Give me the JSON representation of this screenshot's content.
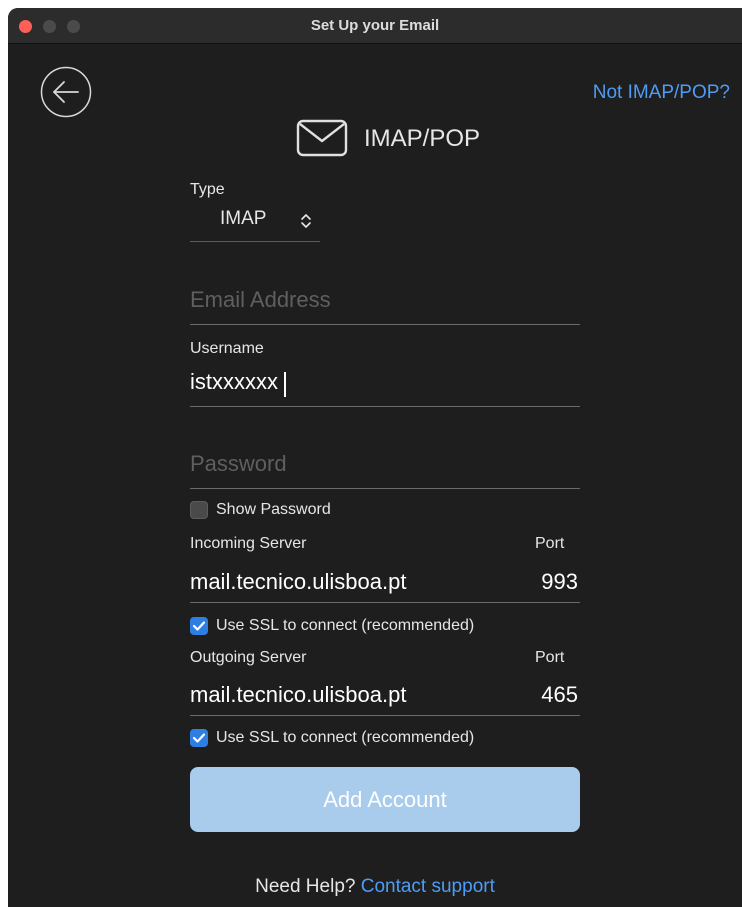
{
  "window": {
    "title": "Set Up your Email"
  },
  "header": {
    "not_imap_link": "Not IMAP/POP?",
    "title": "IMAP/POP"
  },
  "form": {
    "type_label": "Type",
    "type_value": "IMAP",
    "email_placeholder": "Email Address",
    "username_label": "Username",
    "username_value": "istxxxxxx",
    "password_placeholder": "Password",
    "show_password_label": "Show Password",
    "incoming_label": "Incoming Server",
    "incoming_port_label": "Port",
    "incoming_server": "mail.tecnico.ulisboa.pt",
    "incoming_port": "993",
    "incoming_ssl_label": "Use SSL to connect (recommended)",
    "outgoing_label": "Outgoing Server",
    "outgoing_port_label": "Port",
    "outgoing_server": "mail.tecnico.ulisboa.pt",
    "outgoing_port": "465",
    "outgoing_ssl_label": "Use SSL to connect (recommended)"
  },
  "actions": {
    "add_account": "Add Account"
  },
  "help": {
    "prefix": "Need Help?",
    "link": "Contact support"
  },
  "icons": {
    "back": "back-arrow-icon",
    "mail": "envelope-icon",
    "select": "chevron-updown-icon"
  },
  "colors": {
    "accent": "#4e9cf5",
    "button_disabled": "#a9cbec",
    "checkbox_on": "#2f7fe3",
    "window_bg": "#1e1e1e"
  }
}
